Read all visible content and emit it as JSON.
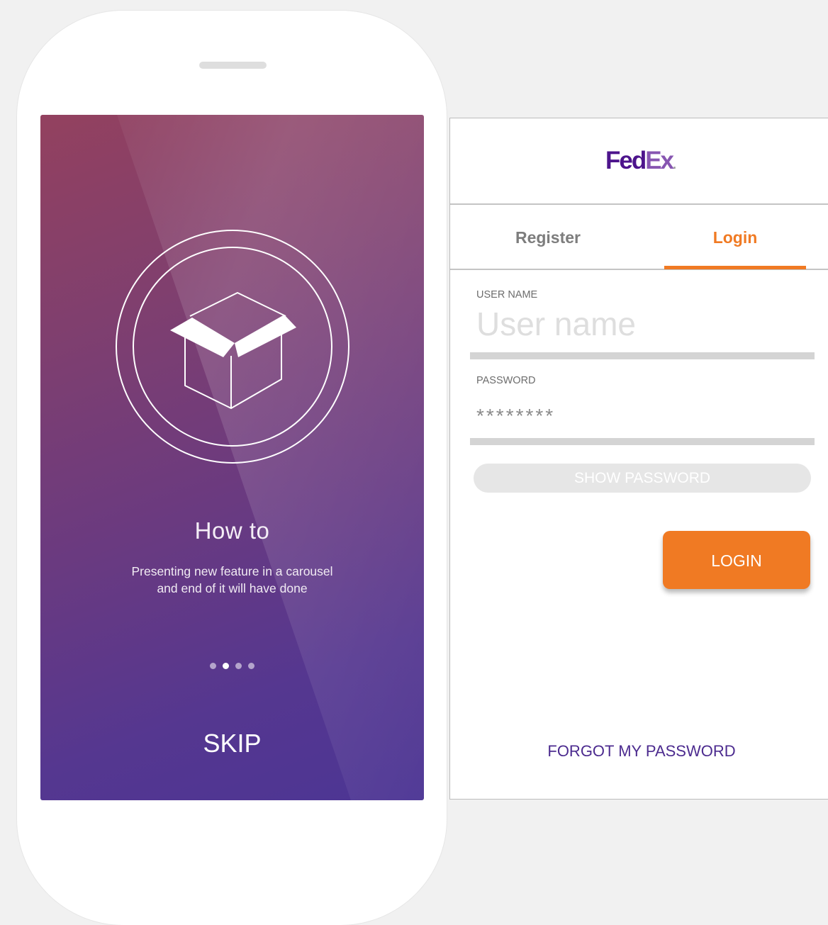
{
  "onboarding": {
    "title": "How to",
    "description": "Presenting new feature in a carousel\nand end of it will have done",
    "dots_total": 4,
    "dot_active_index": 1,
    "skip_label": "SKIP",
    "illustration_icon": "open-box-icon"
  },
  "login_panel": {
    "logo": {
      "fed": "Fed",
      "ex": "Ex",
      "dot": "."
    },
    "tabs": [
      {
        "label": "Register",
        "active": false
      },
      {
        "label": "Login",
        "active": true
      }
    ],
    "username": {
      "label": "USER NAME",
      "placeholder": "User name",
      "value": ""
    },
    "password": {
      "label": "PASSWORD",
      "value": "********"
    },
    "show_password_label": "SHOW PASSWORD",
    "login_button_label": "LOGIN",
    "forgot_password_label": "FORGOT MY PASSWORD"
  },
  "colors": {
    "brand_purple": "#4d148c",
    "brand_orange": "#f07a23",
    "gradient_start": "#93415f",
    "gradient_end": "#4c3594"
  }
}
